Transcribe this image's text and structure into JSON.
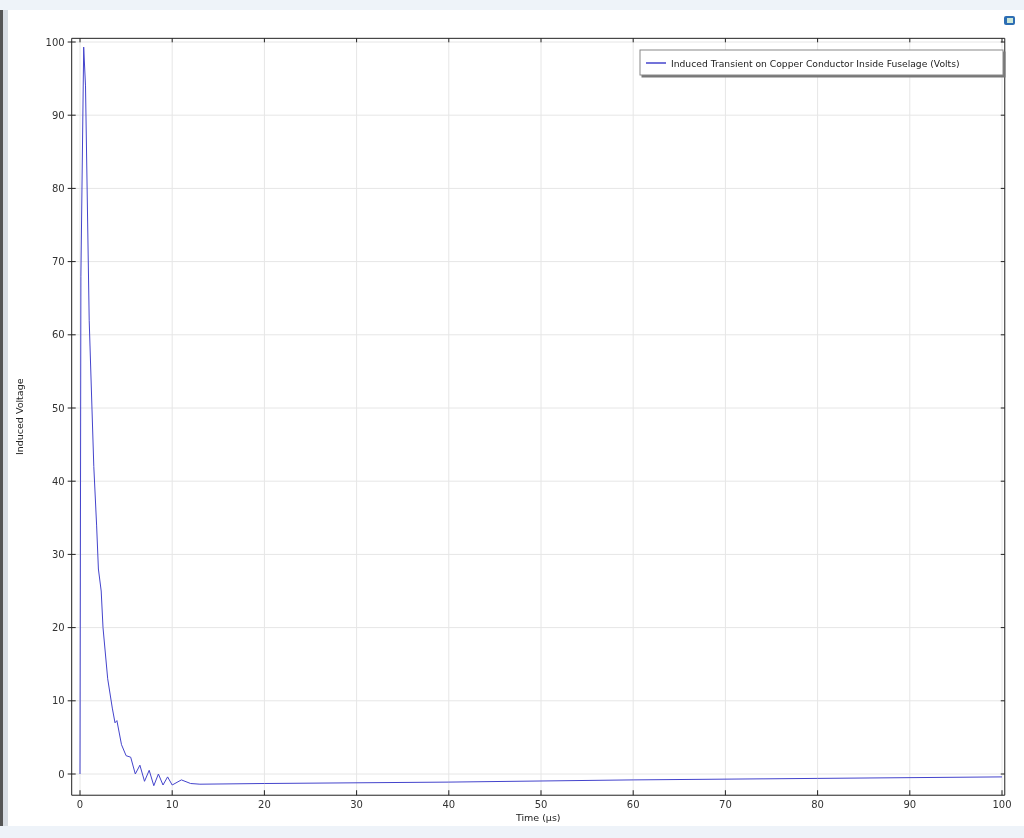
{
  "plot": {
    "chart_data": {
      "type": "line",
      "grid": true,
      "xlabel": "Time (µs)",
      "ylabel": "Induced Voltage",
      "xlim": [
        -0.9,
        100.3
      ],
      "ylim": [
        -2.9,
        100.5
      ],
      "xticks": [
        0,
        10,
        20,
        30,
        40,
        50,
        60,
        70,
        80,
        90,
        100
      ],
      "yticks": [
        0,
        10,
        20,
        30,
        40,
        50,
        60,
        70,
        80,
        90,
        100
      ],
      "x": [
        0,
        0.1,
        0.4,
        0.6,
        1.0,
        1.5,
        1.8,
        2.0,
        2.3,
        2.5,
        3.0,
        3.5,
        3.8,
        4.0,
        4.5,
        5.0,
        5.5,
        6.0,
        6.5,
        7.0,
        7.5,
        8.0,
        8.5,
        9.0,
        9.5,
        10,
        11,
        12,
        13,
        20,
        40,
        60,
        80,
        100
      ],
      "series": [
        {
          "name": "Induced Transient on Copper Conductor Inside Fuselage (Volts)",
          "color": "#4444cc",
          "values": [
            0,
            68,
            99.3,
            94,
            62,
            42,
            34,
            28,
            25,
            20,
            13,
            9,
            7,
            7.3,
            4,
            2.5,
            2.3,
            0,
            1.2,
            -1,
            0.5,
            -1.6,
            0,
            -1.5,
            -0.4,
            -1.5,
            -0.8,
            -1.3,
            -1.4,
            -1.3,
            -1.1,
            -0.8,
            -0.6,
            -0.4
          ]
        }
      ]
    }
  }
}
